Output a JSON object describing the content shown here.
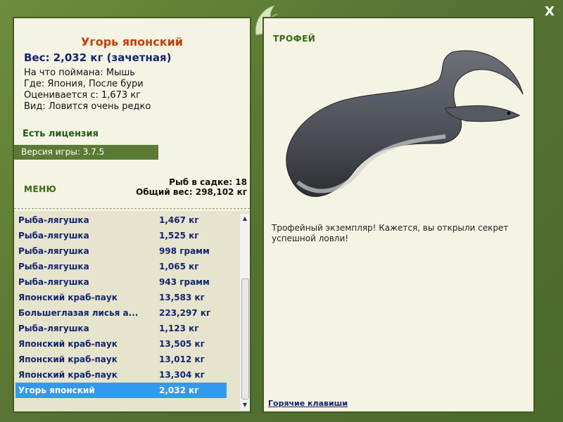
{
  "fish": {
    "title": "Угорь японский",
    "weight": "Вес: 2,032 кг (зачетная)",
    "bait": "На что поймана: Мышь",
    "location": "Где: Япония, После бури",
    "valued_from": "Оценивается с: 1,673 кг",
    "kind": "Вид: Ловится очень редко"
  },
  "license": "Есть лицензия",
  "version": "Версия игры: 3.7.5",
  "menu_label": "МЕНЮ",
  "stats": {
    "fish_in_cage": "Рыб в садке: 18",
    "total_weight": "Общий вес: 298,102 кг"
  },
  "catch_list": [
    {
      "name": "Рыба-лягушка",
      "weight": "1,467 кг"
    },
    {
      "name": "Рыба-лягушка",
      "weight": "1,525 кг"
    },
    {
      "name": "Рыба-лягушка",
      "weight": "998 грамм"
    },
    {
      "name": "Рыба-лягушка",
      "weight": "1,065 кг"
    },
    {
      "name": "Рыба-лягушка",
      "weight": "943 грамм"
    },
    {
      "name": "Японский краб-паук",
      "weight": "13,583 кг"
    },
    {
      "name": "Большеглазая лисья а...",
      "weight": "223,297 кг"
    },
    {
      "name": "Рыба-лягушка",
      "weight": "1,123 кг"
    },
    {
      "name": "Японский краб-паук",
      "weight": "13,505 кг"
    },
    {
      "name": "Японский краб-паук",
      "weight": "13,012 кг"
    },
    {
      "name": "Японский краб-паук",
      "weight": "13,304 кг"
    },
    {
      "name": "Угорь японский",
      "weight": "2,032 кг"
    }
  ],
  "selected_index": 11,
  "trophy": {
    "label": "ТРОФЕЙ",
    "text": "Трофейный экземпляр! Кажется, вы открыли секрет успешной ловли!"
  },
  "hotkeys_link": "Горячие клавиши",
  "close_label": "X",
  "icons": {
    "close": "close-icon",
    "logo": "fish-logo-icon",
    "scroll_up": "arrow-up-icon",
    "scroll_down": "arrow-down-icon"
  },
  "colors": {
    "frame_green": "#5b7a34",
    "title_orange": "#c0410a",
    "text_navy": "#13256e",
    "license_green": "#1d5d16",
    "selected_blue": "#3399ee",
    "panel_bg": "#f5f3e4"
  }
}
